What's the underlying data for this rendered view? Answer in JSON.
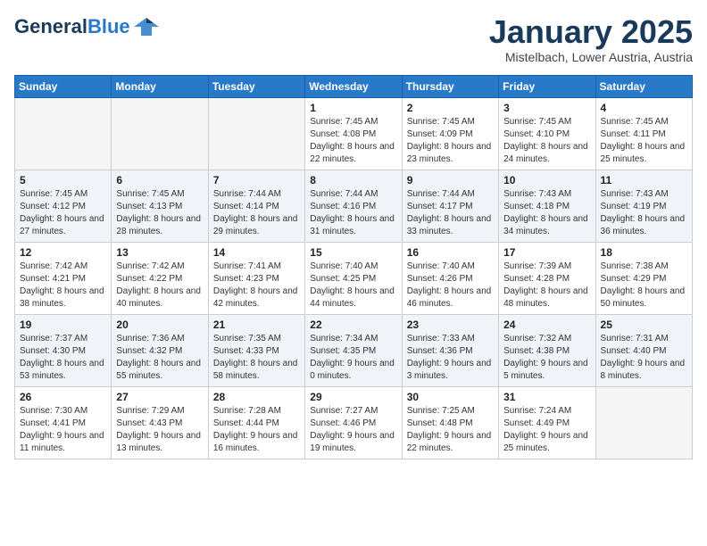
{
  "header": {
    "logo_general": "General",
    "logo_blue": "Blue",
    "month": "January 2025",
    "location": "Mistelbach, Lower Austria, Austria"
  },
  "days_of_week": [
    "Sunday",
    "Monday",
    "Tuesday",
    "Wednesday",
    "Thursday",
    "Friday",
    "Saturday"
  ],
  "weeks": [
    {
      "shaded": false,
      "days": [
        {
          "num": "",
          "info": ""
        },
        {
          "num": "",
          "info": ""
        },
        {
          "num": "",
          "info": ""
        },
        {
          "num": "1",
          "info": "Sunrise: 7:45 AM\nSunset: 4:08 PM\nDaylight: 8 hours and 22 minutes."
        },
        {
          "num": "2",
          "info": "Sunrise: 7:45 AM\nSunset: 4:09 PM\nDaylight: 8 hours and 23 minutes."
        },
        {
          "num": "3",
          "info": "Sunrise: 7:45 AM\nSunset: 4:10 PM\nDaylight: 8 hours and 24 minutes."
        },
        {
          "num": "4",
          "info": "Sunrise: 7:45 AM\nSunset: 4:11 PM\nDaylight: 8 hours and 25 minutes."
        }
      ]
    },
    {
      "shaded": true,
      "days": [
        {
          "num": "5",
          "info": "Sunrise: 7:45 AM\nSunset: 4:12 PM\nDaylight: 8 hours and 27 minutes."
        },
        {
          "num": "6",
          "info": "Sunrise: 7:45 AM\nSunset: 4:13 PM\nDaylight: 8 hours and 28 minutes."
        },
        {
          "num": "7",
          "info": "Sunrise: 7:44 AM\nSunset: 4:14 PM\nDaylight: 8 hours and 29 minutes."
        },
        {
          "num": "8",
          "info": "Sunrise: 7:44 AM\nSunset: 4:16 PM\nDaylight: 8 hours and 31 minutes."
        },
        {
          "num": "9",
          "info": "Sunrise: 7:44 AM\nSunset: 4:17 PM\nDaylight: 8 hours and 33 minutes."
        },
        {
          "num": "10",
          "info": "Sunrise: 7:43 AM\nSunset: 4:18 PM\nDaylight: 8 hours and 34 minutes."
        },
        {
          "num": "11",
          "info": "Sunrise: 7:43 AM\nSunset: 4:19 PM\nDaylight: 8 hours and 36 minutes."
        }
      ]
    },
    {
      "shaded": false,
      "days": [
        {
          "num": "12",
          "info": "Sunrise: 7:42 AM\nSunset: 4:21 PM\nDaylight: 8 hours and 38 minutes."
        },
        {
          "num": "13",
          "info": "Sunrise: 7:42 AM\nSunset: 4:22 PM\nDaylight: 8 hours and 40 minutes."
        },
        {
          "num": "14",
          "info": "Sunrise: 7:41 AM\nSunset: 4:23 PM\nDaylight: 8 hours and 42 minutes."
        },
        {
          "num": "15",
          "info": "Sunrise: 7:40 AM\nSunset: 4:25 PM\nDaylight: 8 hours and 44 minutes."
        },
        {
          "num": "16",
          "info": "Sunrise: 7:40 AM\nSunset: 4:26 PM\nDaylight: 8 hours and 46 minutes."
        },
        {
          "num": "17",
          "info": "Sunrise: 7:39 AM\nSunset: 4:28 PM\nDaylight: 8 hours and 48 minutes."
        },
        {
          "num": "18",
          "info": "Sunrise: 7:38 AM\nSunset: 4:29 PM\nDaylight: 8 hours and 50 minutes."
        }
      ]
    },
    {
      "shaded": true,
      "days": [
        {
          "num": "19",
          "info": "Sunrise: 7:37 AM\nSunset: 4:30 PM\nDaylight: 8 hours and 53 minutes."
        },
        {
          "num": "20",
          "info": "Sunrise: 7:36 AM\nSunset: 4:32 PM\nDaylight: 8 hours and 55 minutes."
        },
        {
          "num": "21",
          "info": "Sunrise: 7:35 AM\nSunset: 4:33 PM\nDaylight: 8 hours and 58 minutes."
        },
        {
          "num": "22",
          "info": "Sunrise: 7:34 AM\nSunset: 4:35 PM\nDaylight: 9 hours and 0 minutes."
        },
        {
          "num": "23",
          "info": "Sunrise: 7:33 AM\nSunset: 4:36 PM\nDaylight: 9 hours and 3 minutes."
        },
        {
          "num": "24",
          "info": "Sunrise: 7:32 AM\nSunset: 4:38 PM\nDaylight: 9 hours and 5 minutes."
        },
        {
          "num": "25",
          "info": "Sunrise: 7:31 AM\nSunset: 4:40 PM\nDaylight: 9 hours and 8 minutes."
        }
      ]
    },
    {
      "shaded": false,
      "days": [
        {
          "num": "26",
          "info": "Sunrise: 7:30 AM\nSunset: 4:41 PM\nDaylight: 9 hours and 11 minutes."
        },
        {
          "num": "27",
          "info": "Sunrise: 7:29 AM\nSunset: 4:43 PM\nDaylight: 9 hours and 13 minutes."
        },
        {
          "num": "28",
          "info": "Sunrise: 7:28 AM\nSunset: 4:44 PM\nDaylight: 9 hours and 16 minutes."
        },
        {
          "num": "29",
          "info": "Sunrise: 7:27 AM\nSunset: 4:46 PM\nDaylight: 9 hours and 19 minutes."
        },
        {
          "num": "30",
          "info": "Sunrise: 7:25 AM\nSunset: 4:48 PM\nDaylight: 9 hours and 22 minutes."
        },
        {
          "num": "31",
          "info": "Sunrise: 7:24 AM\nSunset: 4:49 PM\nDaylight: 9 hours and 25 minutes."
        },
        {
          "num": "",
          "info": ""
        }
      ]
    }
  ]
}
